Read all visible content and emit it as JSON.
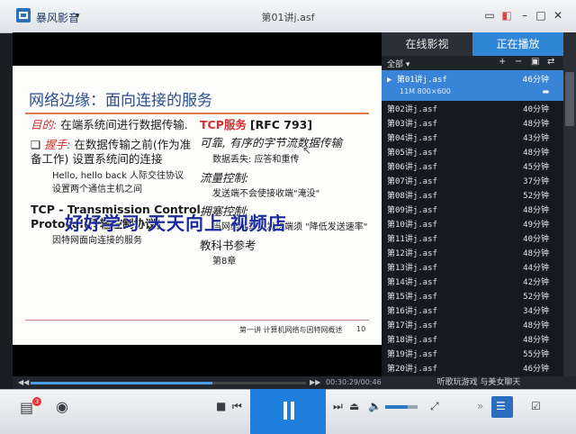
{
  "app": {
    "name": "暴风影音",
    "window_title": "第01讲j.asf"
  },
  "titlebar": {
    "controls": [
      "chat-icon",
      "skin-icon",
      "minimize-icon",
      "maximize-icon",
      "close-icon"
    ]
  },
  "slide": {
    "title": "网络边缘：面向连接的服务",
    "left": {
      "goal_label": "目的:",
      "goal_text": "在端系统间进行数据传输.",
      "bullet1_label": "握手:",
      "bullet1_text": "在数据传输之前(作为准备工作) 设置系统间的连接",
      "sub1": "Hello, hello back 人际交往协议",
      "sub2": "设置两个通信主机之间",
      "bullet2": "TCP - Transmission Control Protocol(传输控制协议)",
      "sub3": "因特网面向连接的服务"
    },
    "right": {
      "heading_red": "TCP服务",
      "heading_ref": "[RFC 793]",
      "item1": "可靠, 有序的字节流数据传输",
      "item1_sub": "数据丢失: 应答和重传",
      "item2": "流量控制:",
      "item2_sub": "发送端不会使接收端\"淹没\"",
      "item3": "拥塞控制:",
      "item3_sub": "当网络拥塞时发送端须 \"降低发送速率\"",
      "item4": "教科书参考",
      "item4_sub": "第8章"
    },
    "footer_text": "第一讲 计算机网络与因特网概述",
    "footer_page": "10"
  },
  "watermark": "好好学习 天天向上 视频店",
  "seekbar": {
    "time": "00:30:29/00:46:05",
    "progress": 0.66
  },
  "panel": {
    "tab_online": "在线影视",
    "tab_playing": "正在播放",
    "filter": "全部",
    "active": {
      "name": "第01讲j.asf",
      "duration": "46分钟",
      "meta": "11M  800×600"
    },
    "items": [
      {
        "name": "第02讲j.asf",
        "duration": "40分钟"
      },
      {
        "name": "第03讲j.asf",
        "duration": "48分钟"
      },
      {
        "name": "第04讲j.asf",
        "duration": "43分钟"
      },
      {
        "name": "第05讲j.asf",
        "duration": "48分钟"
      },
      {
        "name": "第06讲j.asf",
        "duration": "45分钟"
      },
      {
        "name": "第07讲j.asf",
        "duration": "37分钟"
      },
      {
        "name": "第08讲j.asf",
        "duration": "52分钟"
      },
      {
        "name": "第09讲j.asf",
        "duration": "48分钟"
      },
      {
        "name": "第10讲j.asf",
        "duration": "49分钟"
      },
      {
        "name": "第11讲j.asf",
        "duration": "40分钟"
      },
      {
        "name": "第12讲j.asf",
        "duration": "48分钟"
      },
      {
        "name": "第13讲j.asf",
        "duration": "44分钟"
      },
      {
        "name": "第14讲j.asf",
        "duration": "42分钟"
      },
      {
        "name": "第15讲j.asf",
        "duration": "52分钟"
      },
      {
        "name": "第16讲j.asf",
        "duration": "34分钟"
      },
      {
        "name": "第17讲j.asf",
        "duration": "48分钟"
      },
      {
        "name": "第18讲j.asf",
        "duration": "48分钟"
      },
      {
        "name": "第19讲j.asf",
        "duration": "55分钟"
      },
      {
        "name": "第20讲j.asf",
        "duration": "46分钟"
      }
    ],
    "footer": "听歌玩游戏 与美女聊天"
  },
  "controls": {
    "badge": "3",
    "volume": 0.7
  }
}
